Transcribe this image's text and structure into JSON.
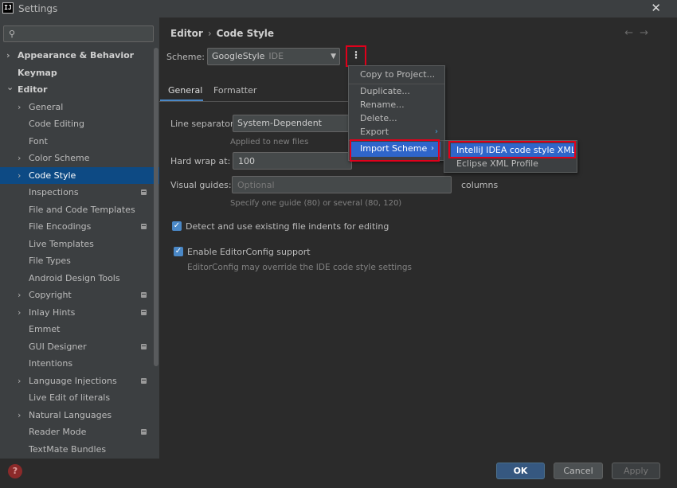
{
  "window": {
    "title": "Settings",
    "app_icon": "IJ"
  },
  "search": {
    "placeholder": ""
  },
  "sidebar": {
    "items": [
      {
        "label": "Appearance & Behavior",
        "level": 0,
        "chevron": true
      },
      {
        "label": "Keymap",
        "level": 0,
        "chevron": false
      },
      {
        "label": "Editor",
        "level": 0,
        "chevron": true,
        "expanded": true
      },
      {
        "label": "General",
        "level": 1,
        "chevron": true
      },
      {
        "label": "Code Editing",
        "level": 1,
        "chevron": false
      },
      {
        "label": "Font",
        "level": 1,
        "chevron": false
      },
      {
        "label": "Color Scheme",
        "level": 1,
        "chevron": true
      },
      {
        "label": "Code Style",
        "level": 1,
        "chevron": true,
        "selected": true
      },
      {
        "label": "Inspections",
        "level": 1,
        "chevron": false,
        "badge": true
      },
      {
        "label": "File and Code Templates",
        "level": 1,
        "chevron": false
      },
      {
        "label": "File Encodings",
        "level": 1,
        "chevron": false,
        "badge": true
      },
      {
        "label": "Live Templates",
        "level": 1,
        "chevron": false
      },
      {
        "label": "File Types",
        "level": 1,
        "chevron": false
      },
      {
        "label": "Android Design Tools",
        "level": 1,
        "chevron": false
      },
      {
        "label": "Copyright",
        "level": 1,
        "chevron": true,
        "badge": true
      },
      {
        "label": "Inlay Hints",
        "level": 1,
        "chevron": true,
        "badge": true
      },
      {
        "label": "Emmet",
        "level": 1,
        "chevron": false
      },
      {
        "label": "GUI Designer",
        "level": 1,
        "chevron": false,
        "badge": true
      },
      {
        "label": "Intentions",
        "level": 1,
        "chevron": false
      },
      {
        "label": "Language Injections",
        "level": 1,
        "chevron": true,
        "badge": true
      },
      {
        "label": "Live Edit of literals",
        "level": 1,
        "chevron": false
      },
      {
        "label": "Natural Languages",
        "level": 1,
        "chevron": true
      },
      {
        "label": "Reader Mode",
        "level": 1,
        "chevron": false,
        "badge": true
      },
      {
        "label": "TextMate Bundles",
        "level": 1,
        "chevron": false
      }
    ]
  },
  "breadcrumb": {
    "parent": "Editor",
    "separator": "›",
    "current": "Code Style"
  },
  "nav": {
    "back": "←",
    "forward": "→"
  },
  "scheme": {
    "label": "Scheme:",
    "value": "GoogleStyle",
    "sub": "IDE",
    "more_glyph": "⋮"
  },
  "tabs": [
    {
      "label": "General",
      "active": true
    },
    {
      "label": "Formatter",
      "active": false
    }
  ],
  "form": {
    "line_separator": {
      "label": "Line separator:",
      "value": "System-Dependent",
      "hint": "Applied to new files"
    },
    "hard_wrap": {
      "label": "Hard wrap at:",
      "value": "100"
    },
    "visual_guides": {
      "label": "Visual guides:",
      "placeholder": "Optional",
      "suffix": "columns",
      "hint": "Specify one guide (80) or several (80, 120)"
    },
    "detect_indents": {
      "label": "Detect and use existing file indents for editing",
      "checked": true
    },
    "editorconfig": {
      "label": "Enable EditorConfig support",
      "checked": true,
      "hint": "EditorConfig may override the IDE code style settings"
    }
  },
  "context_menu": {
    "items": [
      {
        "label": "Copy to Project..."
      },
      {
        "label": "Duplicate..."
      },
      {
        "label": "Rename..."
      },
      {
        "label": "Delete..."
      },
      {
        "label": "Export",
        "submenu": true
      },
      {
        "label": "Import Scheme",
        "submenu": true,
        "highlighted": true
      }
    ]
  },
  "submenu": {
    "items": [
      {
        "label": "IntelliJ IDEA code style XML",
        "highlighted": true
      },
      {
        "label": "Eclipse XML Profile"
      }
    ]
  },
  "footer": {
    "help": "?",
    "ok": "OK",
    "cancel": "Cancel",
    "apply": "Apply"
  },
  "colors": {
    "accent": "#4a88c7",
    "selection": "#0d4a84",
    "menu_highlight": "#2f65ca",
    "annotation_red": "#e0001b"
  }
}
